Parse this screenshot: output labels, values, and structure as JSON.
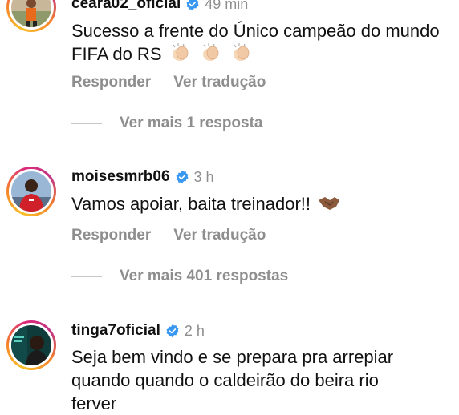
{
  "comments": [
    {
      "username": "ceara02_oficial",
      "time": "49 min",
      "text": "Sucesso a frente do Único campeão do mundo FIFA do RS",
      "emoji": [
        "clapping-hands-icon",
        "clapping-hands-icon",
        "clapping-hands-icon"
      ],
      "reply_label": "Responder",
      "translate_label": "Ver tradução",
      "more_replies": "Ver mais 1 resposta"
    },
    {
      "username": "moisesmrb06",
      "time": "3 h",
      "text": "Vamos apoiar, baita treinador!!",
      "emoji": [
        "handshake-icon"
      ],
      "reply_label": "Responder",
      "translate_label": "Ver tradução",
      "more_replies": "Ver mais 401 respostas"
    },
    {
      "username": "tinga7oficial",
      "time": "2 h",
      "text_lines": [
        "Seja bem vindo e se prepara pra arrepiar",
        "quando quando o caldeirão do beira rio",
        "ferver"
      ]
    }
  ],
  "colors": {
    "verified": "#3897f0",
    "muted": "#8e8e8e",
    "text": "#111111"
  }
}
